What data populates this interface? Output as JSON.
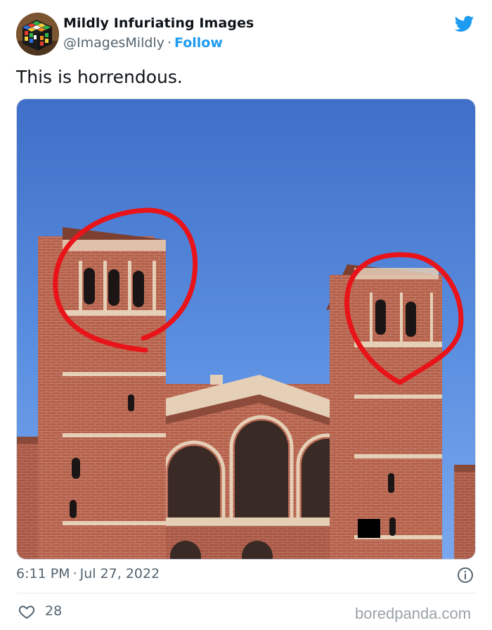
{
  "author": {
    "display_name": "Mildly Infuriating Images",
    "handle": "@ImagesMildly",
    "separator": "·",
    "follow_label": "Follow",
    "avatar_icon": "rubiks-cube-icon"
  },
  "brand_icon": "twitter-bird-icon",
  "brand_color": "#1d9bf0",
  "tweet": {
    "text": "This is horrendous."
  },
  "timestamp": {
    "time": "6:11 PM",
    "separator": "·",
    "date": "Jul 27, 2022"
  },
  "engagement": {
    "likes": "28",
    "like_icon": "heart-icon",
    "info_icon": "info-icon"
  },
  "watermark": "boredpanda.com"
}
